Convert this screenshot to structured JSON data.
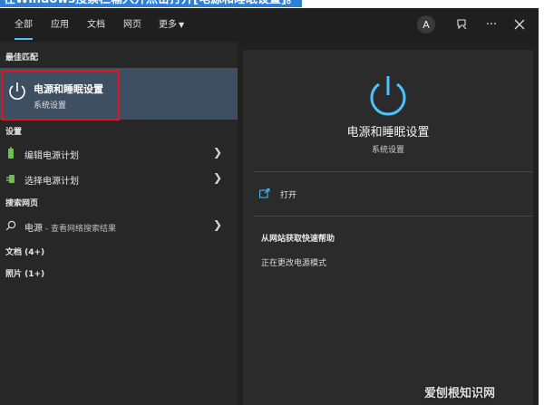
{
  "caption": "在Windows搜索栏输入并点击打开[电源和睡眠设置]。",
  "tabs": [
    {
      "label": "全部"
    },
    {
      "label": "应用"
    },
    {
      "label": "文档"
    },
    {
      "label": "网页"
    },
    {
      "label": "更多"
    }
  ],
  "avatar_letter": "A",
  "left": {
    "best_match_label": "最佳匹配",
    "best_match": {
      "title": "电源和睡眠设置",
      "subtitle": "系统设置"
    },
    "settings_label": "设置",
    "settings_items": [
      {
        "label": "编辑电源计划"
      },
      {
        "label": "选择电源计划"
      }
    ],
    "web_label": "搜索网页",
    "web_item": {
      "term": "电源",
      "hint": " - 查看网络搜索结果"
    },
    "docs_label": "文档 (4+)",
    "photos_label": "照片 (1+)"
  },
  "right": {
    "title": "电源和睡眠设置",
    "subtitle": "系统设置",
    "open_label": "打开",
    "help_title": "从网站获取快速帮助",
    "help_link": "正在更改电源模式"
  },
  "watermark": "爱刨根知识网",
  "colors": {
    "accent": "#4cc2ff",
    "highlight": "#3d4f61",
    "outline": "#e4141f",
    "caption_bg": "#2f7fd8"
  }
}
